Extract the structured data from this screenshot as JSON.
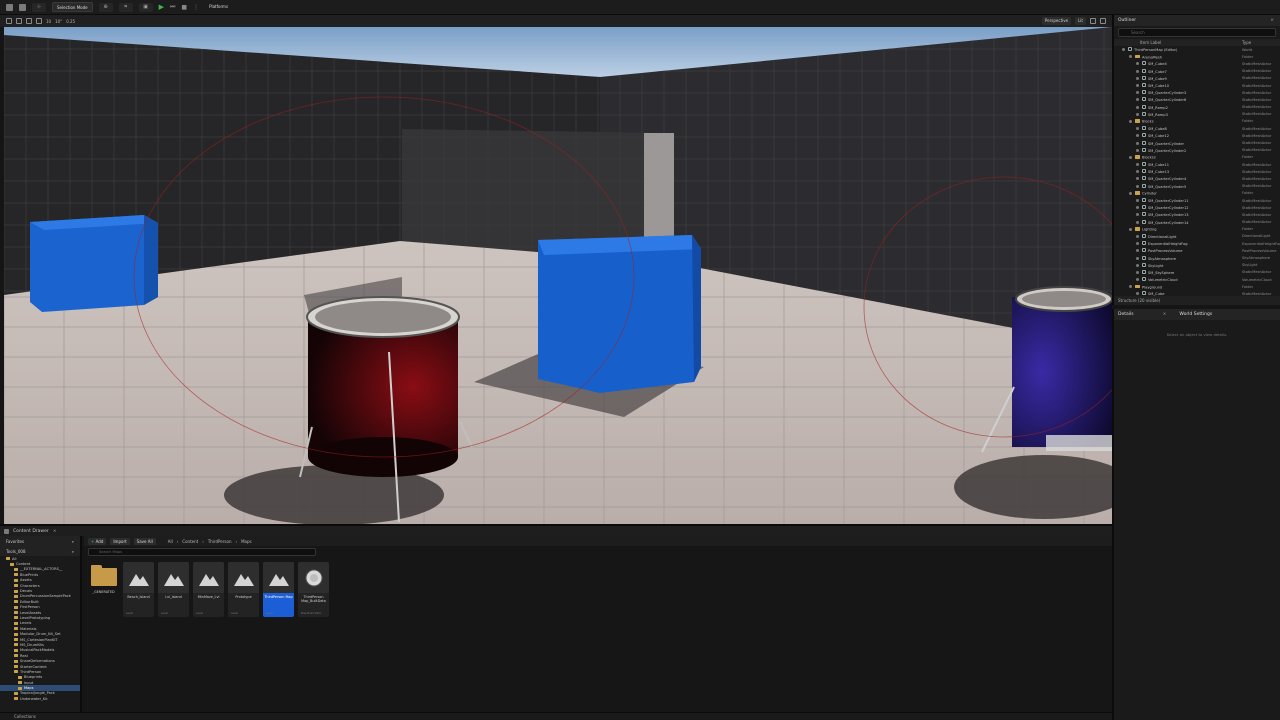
{
  "toolbar": {
    "mode_label": "Selection Mode",
    "platforms_label": "Platforms"
  },
  "viewport_toolbar": {
    "perspective_label": "Perspective",
    "lit_label": "Lit",
    "left_values": [
      "10",
      "10°",
      "0.25"
    ]
  },
  "outliner": {
    "tab_label": "Outliner",
    "search_placeholder": "Search",
    "col_label": "Item Label",
    "col_type": "Type",
    "footer": "Structure (20 visible)",
    "rows": [
      {
        "indent": 0,
        "kind": "world",
        "label": "ThirdPersonMap (Editor)",
        "type": "World"
      },
      {
        "indent": 1,
        "kind": "folder",
        "label": "ArenaMesh",
        "type": "Folder"
      },
      {
        "indent": 2,
        "kind": "mesh",
        "label": "SM_Cube4",
        "type": "StaticMeshActor"
      },
      {
        "indent": 2,
        "kind": "mesh",
        "label": "SM_Cube7",
        "type": "StaticMeshActor"
      },
      {
        "indent": 2,
        "kind": "mesh",
        "label": "SM_Cube9",
        "type": "StaticMeshActor"
      },
      {
        "indent": 2,
        "kind": "mesh",
        "label": "SM_Cube10",
        "type": "StaticMeshActor"
      },
      {
        "indent": 2,
        "kind": "mesh",
        "label": "SM_QuarterCylinder3",
        "type": "StaticMeshActor"
      },
      {
        "indent": 2,
        "kind": "mesh",
        "label": "SM_QuarterCylinder6",
        "type": "StaticMeshActor"
      },
      {
        "indent": 2,
        "kind": "mesh",
        "label": "SM_Ramp2",
        "type": "StaticMeshActor"
      },
      {
        "indent": 2,
        "kind": "mesh",
        "label": "SM_Ramp3",
        "type": "StaticMeshActor"
      },
      {
        "indent": 1,
        "kind": "folder",
        "label": "Blocks",
        "type": "Folder"
      },
      {
        "indent": 2,
        "kind": "mesh",
        "label": "SM_Cube8",
        "type": "StaticMeshActor"
      },
      {
        "indent": 2,
        "kind": "mesh",
        "label": "SM_Cube12",
        "type": "StaticMeshActor"
      },
      {
        "indent": 2,
        "kind": "mesh",
        "label": "SM_QuarterCylinder",
        "type": "StaticMeshActor"
      },
      {
        "indent": 2,
        "kind": "mesh",
        "label": "SM_QuarterCylinder2",
        "type": "StaticMeshActor"
      },
      {
        "indent": 1,
        "kind": "folder",
        "label": "Blocks2",
        "type": "Folder"
      },
      {
        "indent": 2,
        "kind": "mesh",
        "label": "SM_Cube11",
        "type": "StaticMeshActor"
      },
      {
        "indent": 2,
        "kind": "mesh",
        "label": "SM_Cube13",
        "type": "StaticMeshActor"
      },
      {
        "indent": 2,
        "kind": "mesh",
        "label": "SM_QuarterCylinder4",
        "type": "StaticMeshActor"
      },
      {
        "indent": 2,
        "kind": "mesh",
        "label": "SM_QuarterCylinder5",
        "type": "StaticMeshActor"
      },
      {
        "indent": 1,
        "kind": "folder",
        "label": "Cylinder",
        "type": "Folder"
      },
      {
        "indent": 2,
        "kind": "mesh",
        "label": "SM_QuarterCylinder11",
        "type": "StaticMeshActor"
      },
      {
        "indent": 2,
        "kind": "mesh",
        "label": "SM_QuarterCylinder12",
        "type": "StaticMeshActor"
      },
      {
        "indent": 2,
        "kind": "mesh",
        "label": "SM_QuarterCylinder13",
        "type": "StaticMeshActor"
      },
      {
        "indent": 2,
        "kind": "mesh",
        "label": "SM_QuarterCylinder14",
        "type": "StaticMeshActor"
      },
      {
        "indent": 1,
        "kind": "folder",
        "label": "Lighting",
        "type": "Folder"
      },
      {
        "indent": 2,
        "kind": "mesh",
        "label": "DirectionalLight",
        "type": "DirectionalLight"
      },
      {
        "indent": 2,
        "kind": "mesh",
        "label": "ExponentialHeightFog",
        "type": "ExponentialHeightFog"
      },
      {
        "indent": 2,
        "kind": "mesh",
        "label": "PostProcessVolume",
        "type": "PostProcessVolume"
      },
      {
        "indent": 2,
        "kind": "mesh",
        "label": "SkyAtmosphere",
        "type": "SkyAtmosphere"
      },
      {
        "indent": 2,
        "kind": "mesh",
        "label": "SkyLight",
        "type": "SkyLight"
      },
      {
        "indent": 2,
        "kind": "mesh",
        "label": "SM_SkySphere",
        "type": "StaticMeshActor"
      },
      {
        "indent": 2,
        "kind": "mesh",
        "label": "VolumetricCloud",
        "type": "VolumetricCloud"
      },
      {
        "indent": 1,
        "kind": "folder",
        "label": "Playground",
        "type": "Folder"
      },
      {
        "indent": 2,
        "kind": "mesh",
        "label": "SM_Cube",
        "type": "StaticMeshActor"
      }
    ]
  },
  "details": {
    "tab_label": "Details",
    "world_settings_label": "World Settings",
    "empty_msg": "Select an object to view details."
  },
  "content_browser": {
    "tab_label": "Content Drawer",
    "add_label": "Add",
    "import_label": "Import",
    "save_all_label": "Save All",
    "breadcrumb": [
      "All",
      "Content",
      "ThirdPerson",
      "Maps"
    ],
    "search_placeholder": "Search Maps",
    "favorites_label": "Favorites",
    "project_label": "Tools_008",
    "tree": [
      {
        "indent": 0,
        "label": "All",
        "sel": false
      },
      {
        "indent": 1,
        "label": "Content",
        "sel": false
      },
      {
        "indent": 2,
        "label": "__EXTERNAL_ACTORS__",
        "sel": false
      },
      {
        "indent": 2,
        "label": "BluePrints",
        "sel": false
      },
      {
        "indent": 2,
        "label": "Assets",
        "sel": false
      },
      {
        "indent": 2,
        "label": "Characters",
        "sel": false
      },
      {
        "indent": 2,
        "label": "Decals",
        "sel": false
      },
      {
        "indent": 2,
        "label": "DrumPercussionSamplePack",
        "sel": false
      },
      {
        "indent": 2,
        "label": "EditorBuilt",
        "sel": false
      },
      {
        "indent": 2,
        "label": "FirstPerson",
        "sel": false
      },
      {
        "indent": 2,
        "label": "LevelAssets",
        "sel": false
      },
      {
        "indent": 2,
        "label": "LevelPrototyping",
        "sel": false
      },
      {
        "indent": 2,
        "label": "Levels",
        "sel": false
      },
      {
        "indent": 2,
        "label": "Materials",
        "sel": false
      },
      {
        "indent": 2,
        "label": "Modular_Drum_Kit_Set",
        "sel": false
      },
      {
        "indent": 2,
        "label": "MS_CartesianPlanKIT",
        "sel": false
      },
      {
        "indent": 2,
        "label": "MS_DrumKits",
        "sel": false
      },
      {
        "indent": 2,
        "label": "MusicalPackModels",
        "sel": false
      },
      {
        "indent": 2,
        "label": "Real",
        "sel": false
      },
      {
        "indent": 2,
        "label": "SnareDeformations",
        "sel": false
      },
      {
        "indent": 2,
        "label": "StarterContent",
        "sel": false
      },
      {
        "indent": 2,
        "label": "ThirdPerson",
        "sel": false
      },
      {
        "indent": 3,
        "label": "Blueprints",
        "sel": false
      },
      {
        "indent": 3,
        "label": "Input",
        "sel": false
      },
      {
        "indent": 3,
        "label": "Maps",
        "sel": true
      },
      {
        "indent": 2,
        "label": "TropicalJungle_Pack",
        "sel": false
      },
      {
        "indent": 2,
        "label": "Underwater_Kit",
        "sel": false
      }
    ],
    "assets": [
      {
        "kind": "folder",
        "label": "_GENERATED",
        "sub": "",
        "sel": false
      },
      {
        "kind": "map",
        "label": "Beach_Island",
        "sub": "Level",
        "sel": false
      },
      {
        "kind": "map",
        "label": "Lvl_Island",
        "sub": "Level",
        "sel": false
      },
      {
        "kind": "map",
        "label": "MtnMaze_Lvl",
        "sub": "Level",
        "sel": false
      },
      {
        "kind": "map",
        "label": "Prototype",
        "sub": "Level",
        "sel": false
      },
      {
        "kind": "map",
        "label": "ThirdPerson Map",
        "sub": "Level",
        "sel": true
      },
      {
        "kind": "sphere",
        "label": "ThirdPerson Map_BuiltData",
        "sub": "Map Build Data",
        "sel": false
      }
    ],
    "collections_label": "Collections"
  },
  "colors": {
    "accent": "#1b5ed6",
    "folder": "#c69a49",
    "play_green": "#3fba4a",
    "cube_blue": "#1a64d2"
  }
}
